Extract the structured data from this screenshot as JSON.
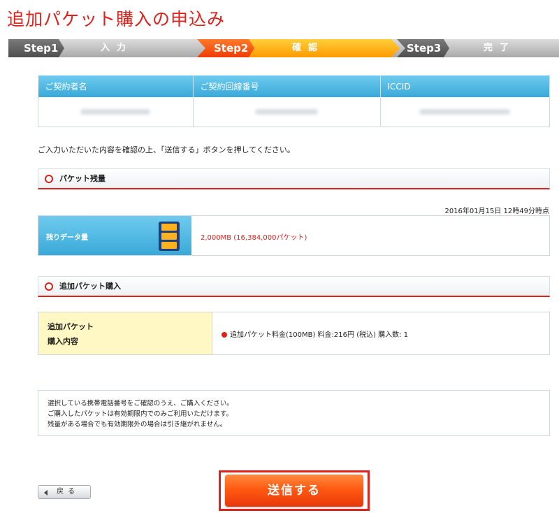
{
  "page": {
    "title": "追加パケット購入の申込み"
  },
  "steps": [
    {
      "num": "Step1",
      "name": "入力",
      "active": false
    },
    {
      "num": "Step2",
      "name": "確認",
      "active": true
    },
    {
      "num": "Step3",
      "name": "完了",
      "active": false
    }
  ],
  "contract_table": {
    "headers": [
      "ご契約者名",
      "ご契約回線番号",
      "ICCID"
    ]
  },
  "instruction": "ご入力いただいた内容を確認の上、「送信する」ボタンを押してください。",
  "packet_remaining": {
    "section_title": "パケット残量",
    "timestamp": "2016年01月15日 12時49分時点",
    "label": "残りデータ量",
    "value": "2,000MB (16,384,000パケット)"
  },
  "additional_purchase": {
    "section_title": "追加パケット購入",
    "label_line1": "追加パケット",
    "label_line2": "購入内容",
    "value": "追加パケット料金(100MB) 料金:216円 (税込) 購入数: 1"
  },
  "notes": [
    "選択している携帯電話番号をご確認のうえ、ご購入ください。",
    "ご購入したパケットは有効期限内でのみご利用いただけます。",
    "残量がある場合でも有効期限外の場合は引き継がれません。"
  ],
  "buttons": {
    "back": "戻る",
    "send": "送信する"
  },
  "colors": {
    "accent_red": "#e0201b",
    "step_active": "#ff9a00",
    "header_blue": "#3aa9d9"
  }
}
